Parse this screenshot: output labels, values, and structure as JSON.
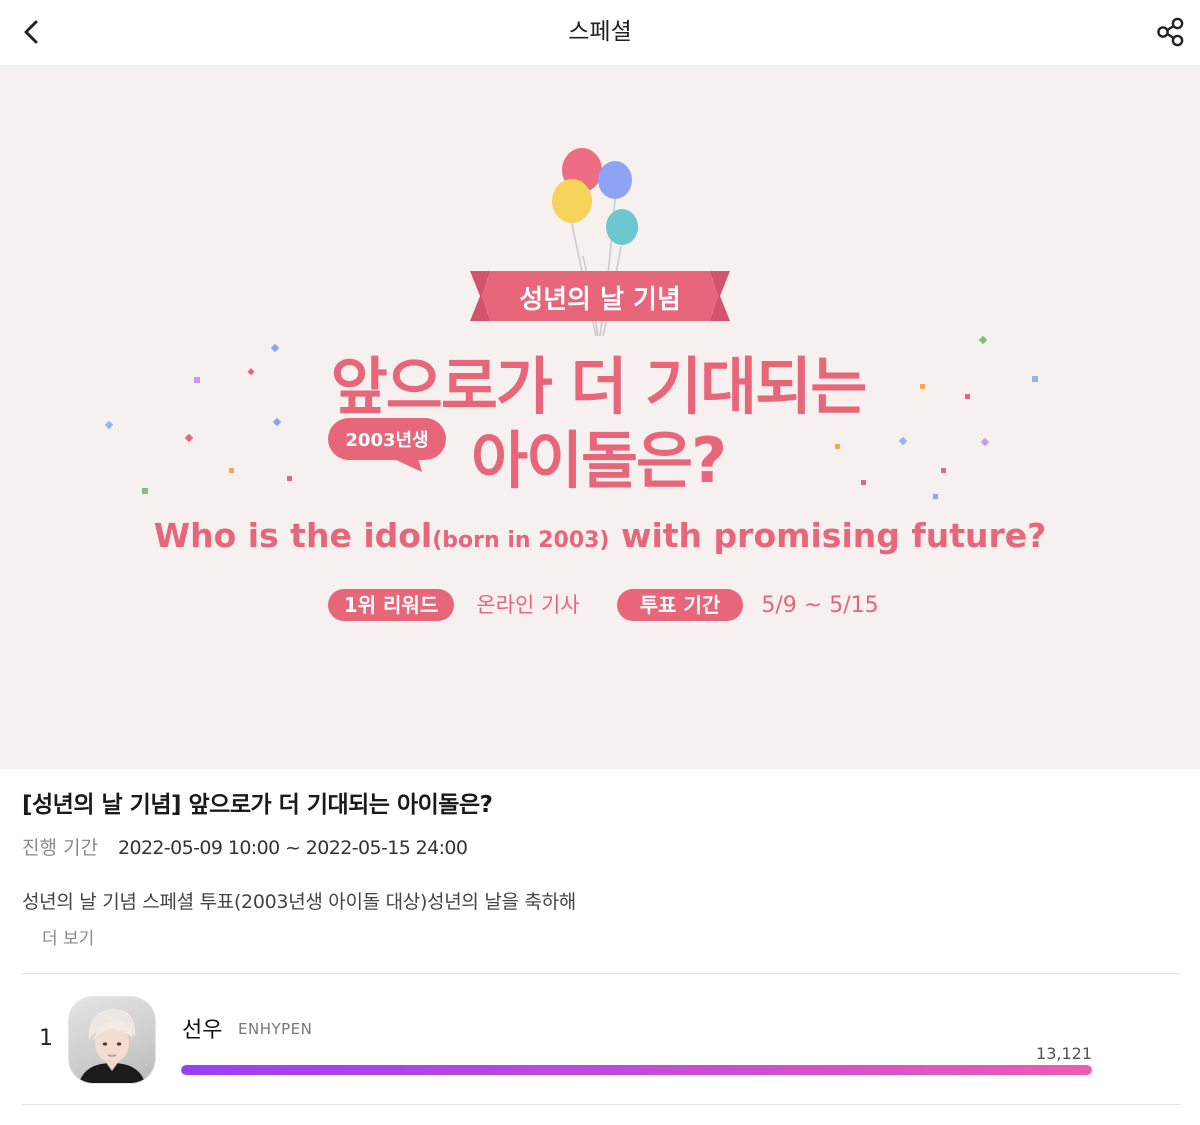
{
  "header": {
    "title": "스페셜",
    "back_icon": "chevron-left-icon",
    "share_icon": "share-icon"
  },
  "banner": {
    "badge": "성년의 날 기념",
    "headline_1": "앞으로가 더 기대되는",
    "bubble": "2003년생",
    "headline_2": "아이돌은?",
    "english_a": "Who is the idol",
    "english_b": "(born in 2003)",
    "english_c": " with promising future?",
    "reward_label": "1위 리워드",
    "reward_value": "온라인 기사",
    "vote_label": "투표 기간",
    "vote_value": "5/9 ~ 5/15",
    "colors": {
      "background": "#f6f0ef",
      "accent_pink": "#e8667a",
      "balloon_red": "#ec6d84",
      "balloon_blue": "#8fa3f5",
      "balloon_yellow": "#f6d35a",
      "balloon_teal": "#6ec6cf"
    }
  },
  "event": {
    "title": "[성년의 날 기념] 앞으로가 더 기대되는 아이돌은?",
    "period_label": "진행 기간",
    "period_value": "2022-05-09 10:00 ~ 2022-05-15 24:00",
    "description": "성년의 날 기념 스페셜 투표(2003년생 아이돌 대상)성년의 날을 축하해",
    "more_label": "더 보기"
  },
  "ranking": [
    {
      "rank": "1",
      "name": "선우",
      "group": "ENHYPEN",
      "votes": "13,121",
      "share": 1.0
    }
  ],
  "colors": {
    "bar_start": "#9a3ff5",
    "bar_end": "#ee5bb4"
  }
}
